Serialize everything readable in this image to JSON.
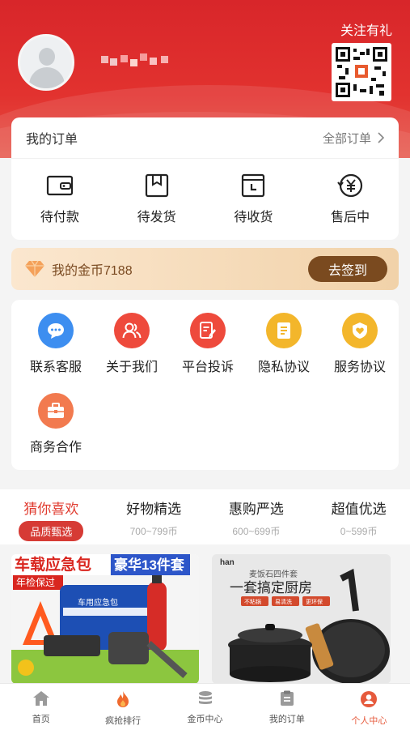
{
  "header": {
    "follow_label": "关注有礼"
  },
  "orders": {
    "title": "我的订单",
    "all_label": "全部订单",
    "items": [
      {
        "label": "待付款",
        "icon": "wallet-icon"
      },
      {
        "label": "待发货",
        "icon": "box-icon"
      },
      {
        "label": "待收货",
        "icon": "package-received-icon"
      },
      {
        "label": "售后中",
        "icon": "yen-refund-icon"
      }
    ]
  },
  "coins": {
    "text": "我的金币7188",
    "checkin_label": "去签到"
  },
  "services": [
    {
      "label": "联系客服",
      "icon": "chat-bubble-icon",
      "color": "#3d8ef0"
    },
    {
      "label": "关于我们",
      "icon": "users-icon",
      "color": "#ee4a3c"
    },
    {
      "label": "平台投诉",
      "icon": "complaint-edit-icon",
      "color": "#ee4a3c"
    },
    {
      "label": "隐私协议",
      "icon": "document-icon",
      "color": "#f3b62b"
    },
    {
      "label": "服务协议",
      "icon": "shield-heart-icon",
      "color": "#f3b62b"
    },
    {
      "label": "商务合作",
      "icon": "briefcase-icon",
      "color": "#f27a4f"
    }
  ],
  "feed_tabs": [
    {
      "title": "猜你喜欢",
      "sub": "品质甄选"
    },
    {
      "title": "好物精选",
      "sub": "700~799币"
    },
    {
      "title": "惠购严选",
      "sub": "600~699币"
    },
    {
      "title": "超值优选",
      "sub": "0~599币"
    }
  ],
  "products": [
    {
      "headline_a": "车载应急包",
      "headline_b": "豪华13件套",
      "tag": "年检保过",
      "bag_text": "车用应急包"
    },
    {
      "brand": "han",
      "subtitle": "麦饭石四件套",
      "headline": "一套搞定厨房",
      "tags": [
        "不粘锅",
        "易清洗",
        "更环保"
      ]
    }
  ],
  "bottom_nav": [
    {
      "label": "首页",
      "icon": "home-icon"
    },
    {
      "label": "疯抢排行",
      "icon": "fire-icon"
    },
    {
      "label": "金币中心",
      "icon": "coin-stack-icon"
    },
    {
      "label": "我的订单",
      "icon": "order-list-icon"
    },
    {
      "label": "个人中心",
      "icon": "profile-icon"
    }
  ]
}
